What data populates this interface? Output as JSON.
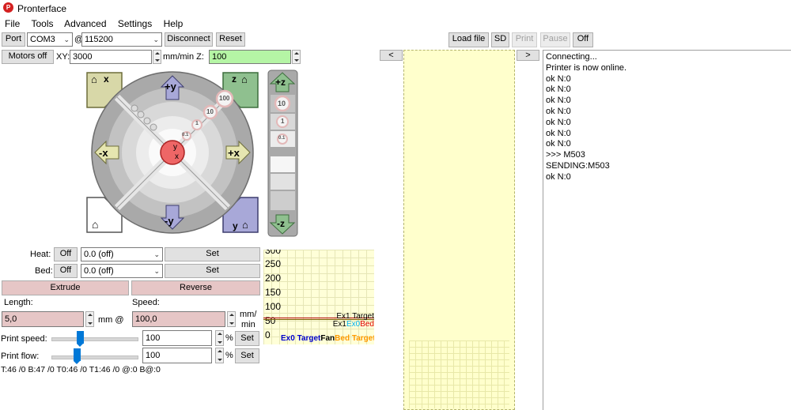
{
  "window": {
    "title": "Pronterface"
  },
  "menu": [
    "File",
    "Tools",
    "Advanced",
    "Settings",
    "Help"
  ],
  "connection": {
    "port_label": "Port",
    "port_value": "COM3",
    "at": "@",
    "baud_value": "115200",
    "disconnect_label": "Disconnect",
    "reset_label": "Reset"
  },
  "motion": {
    "motors_off_label": "Motors off",
    "xy_label": "XY:",
    "xy_value": "3000",
    "z_unit_label": "mm/min Z:",
    "z_value": "100"
  },
  "jog": {
    "home_x": "x",
    "home_z": "z",
    "home_y": "y",
    "plus_y": "+y",
    "minus_y": "-y",
    "plus_x": "+x",
    "minus_x": "-x",
    "center_y": "y",
    "center_x": "x",
    "dist_100": "100",
    "dist_10": "10",
    "dist_1": "1",
    "dist_01": "0.1",
    "plus_z": "+z",
    "minus_z": "-z",
    "z_10": "10",
    "z_1": "1",
    "z_01": "0.1"
  },
  "temps": {
    "heat_label": "Heat:",
    "heat_off": "Off",
    "heat_value": "0.0 (off)",
    "heat_set": "Set",
    "bed_label": "Bed:",
    "bed_off": "Off",
    "bed_value": "0.0 (off)",
    "bed_set": "Set"
  },
  "extrude": {
    "extrude_label": "Extrude",
    "reverse_label": "Reverse",
    "length_label": "Length:",
    "speed_label": "Speed:",
    "length_value": "5,0",
    "mm_at": "mm @",
    "speed_value": "100,0",
    "mm_label": "mm/",
    "min_label": "min"
  },
  "print_settings": {
    "print_speed_label": "Print speed:",
    "print_speed_value": "100",
    "print_speed_level": 0.33,
    "print_flow_label": "Print flow:",
    "print_flow_value": "100",
    "print_flow_level": 0.33,
    "percent": "%",
    "set_label": "Set"
  },
  "status_line": "T:46 /0 B:47 /0 T0:46 /0 T1:46 /0 @:0 B@:0",
  "graph": {
    "y_ticks": [
      "300",
      "250",
      "200",
      "150",
      "100",
      "50",
      "0"
    ],
    "legend": {
      "ex1_target": "Ex1 Target",
      "ex1": "Ex1",
      "ex0": "Ex0",
      "bed": "Bed",
      "ex0_target": "Ex0 Target",
      "fan": "Fan",
      "bed_target": "Bed Target"
    },
    "colors": {
      "ex1_target": "#000000",
      "ex1": "#000000",
      "ex0": "#00b0f0",
      "bed": "#e00000",
      "ex0_target": "#0000cc",
      "fan": "#000000",
      "bed_target": "#ff9900"
    }
  },
  "sd_bar": {
    "load_file_label": "Load file",
    "sd_label": "SD",
    "print_label": "Print",
    "pause_label": "Pause",
    "off_label": "Off"
  },
  "nav": {
    "left_arrow": "<",
    "right_arrow": ">"
  },
  "log": [
    "Connecting...",
    "Printer is now online.",
    "ok N:0",
    "ok N:0",
    "ok N:0",
    "ok N:0",
    "ok N:0",
    "ok N:0",
    "ok N:0",
    ">>> M503",
    "SENDING:M503",
    "ok N:0"
  ]
}
